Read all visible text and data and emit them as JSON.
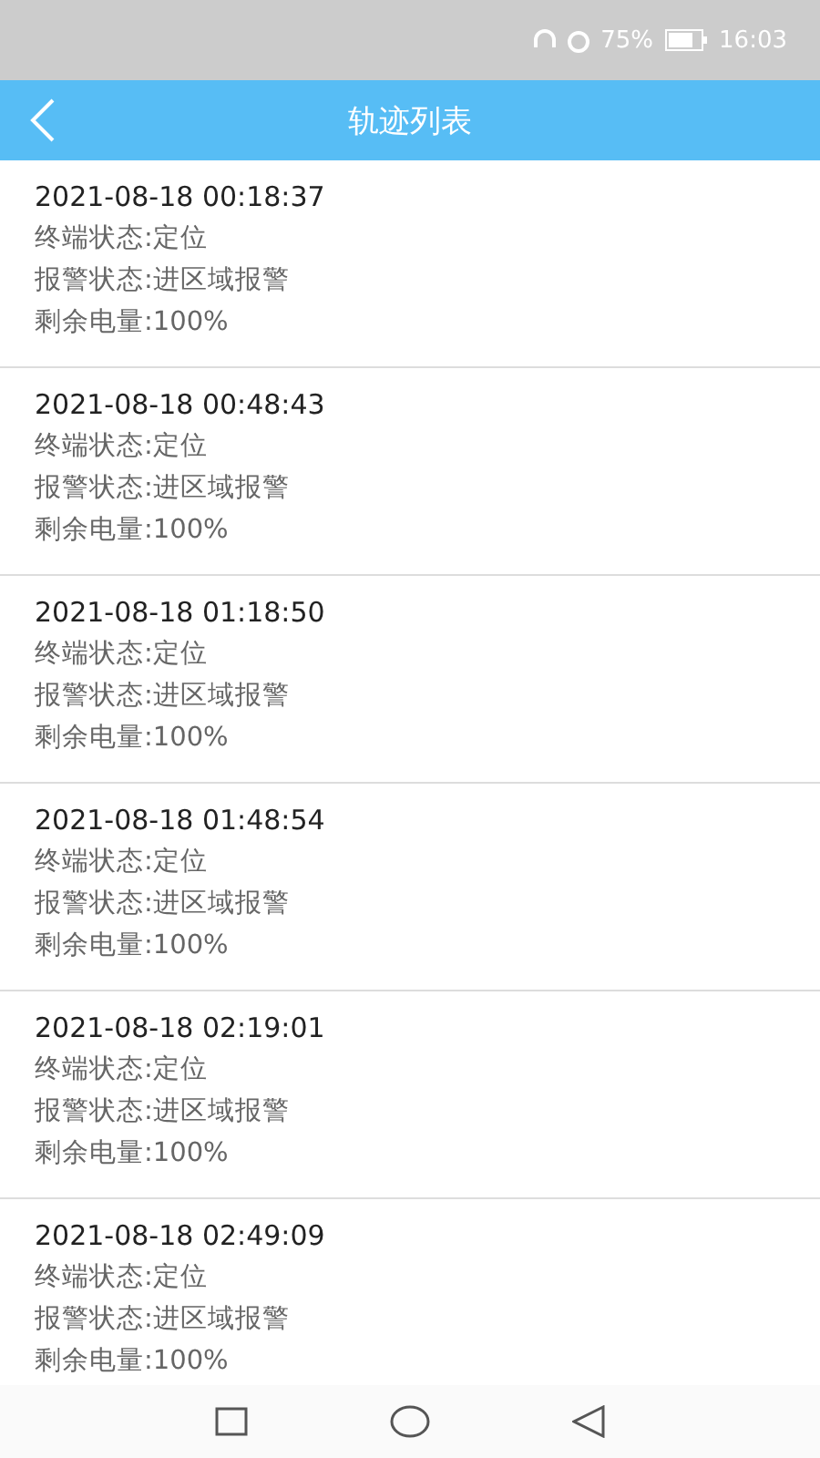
{
  "status_bar": {
    "battery": "75%",
    "time": "16:03"
  },
  "header": {
    "title": "轨迹列表"
  },
  "records": [
    {
      "time": "2021-08-18 00:18:37",
      "lines": [
        "终端状态:定位",
        "报警状态:进区域报警",
        "剩余电量:100%"
      ]
    },
    {
      "time": "2021-08-18 00:48:43",
      "lines": [
        "终端状态:定位",
        "报警状态:进区域报警",
        "剩余电量:100%"
      ]
    },
    {
      "time": "2021-08-18 01:18:50",
      "lines": [
        "终端状态:定位",
        "报警状态:进区域报警",
        "剩余电量:100%"
      ]
    },
    {
      "time": "2021-08-18 01:48:54",
      "lines": [
        "终端状态:定位",
        "报警状态:进区域报警",
        "剩余电量:100%"
      ]
    },
    {
      "time": "2021-08-18 02:19:01",
      "lines": [
        "终端状态:定位",
        "报警状态:进区域报警",
        "剩余电量:100%"
      ]
    },
    {
      "time": "2021-08-18 02:49:09",
      "lines": [
        "终端状态:定位",
        "报警状态:进区域报警",
        "剩余电量:100%"
      ]
    }
  ]
}
